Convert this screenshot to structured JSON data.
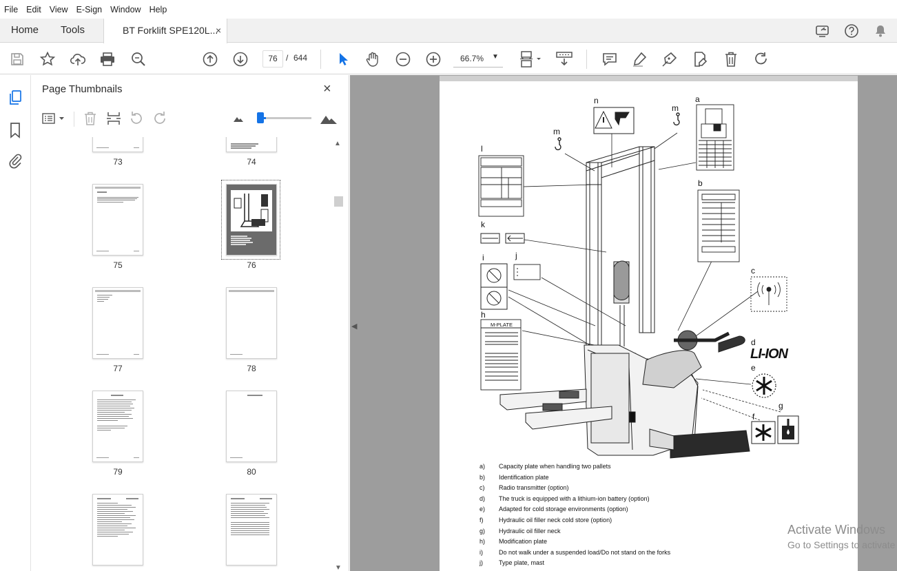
{
  "menu": [
    "File",
    "Edit",
    "View",
    "E-Sign",
    "Window",
    "Help"
  ],
  "tabs": {
    "home": "Home",
    "tools": "Tools",
    "document": "BT Forklift SPE120L...",
    "close": "×"
  },
  "toolbar": {
    "page_current": "76",
    "page_separator": "/",
    "page_total": "644",
    "zoom": "66.7%"
  },
  "panel": {
    "title": "Page Thumbnails",
    "close": "×",
    "thumbnails": [
      "73",
      "74",
      "75",
      "76",
      "77",
      "78",
      "79",
      "80"
    ],
    "selected_page": "76"
  },
  "diagram": {
    "callouts": [
      "a",
      "b",
      "c",
      "d",
      "e",
      "f",
      "g",
      "h",
      "i",
      "j",
      "k",
      "l",
      "m",
      "m",
      "n"
    ],
    "mplate_label": "M-PLATE",
    "li_ion_label": "LI-ION"
  },
  "legend": [
    {
      "key": "a)",
      "text": "Capacity plate when handling two pallets"
    },
    {
      "key": "b)",
      "text": "Identification plate"
    },
    {
      "key": "c)",
      "text": "Radio transmitter (option)"
    },
    {
      "key": "d)",
      "text": "The truck is equipped with a lithium-ion battery (option)"
    },
    {
      "key": "e)",
      "text": "Adapted for cold storage environments (option)"
    },
    {
      "key": "f)",
      "text": "Hydraulic oil filler neck cold store (option)"
    },
    {
      "key": "g)",
      "text": "Hydraulic oil filler neck"
    },
    {
      "key": "h)",
      "text": "Modification plate"
    },
    {
      "key": "i)",
      "text": "Do not walk under a suspended load/Do not stand on the forks"
    },
    {
      "key": "j)",
      "text": "Type plate, mast"
    }
  ],
  "watermark": {
    "line1": "Activate Windows",
    "line2": "Go to Settings to activate Windows."
  }
}
